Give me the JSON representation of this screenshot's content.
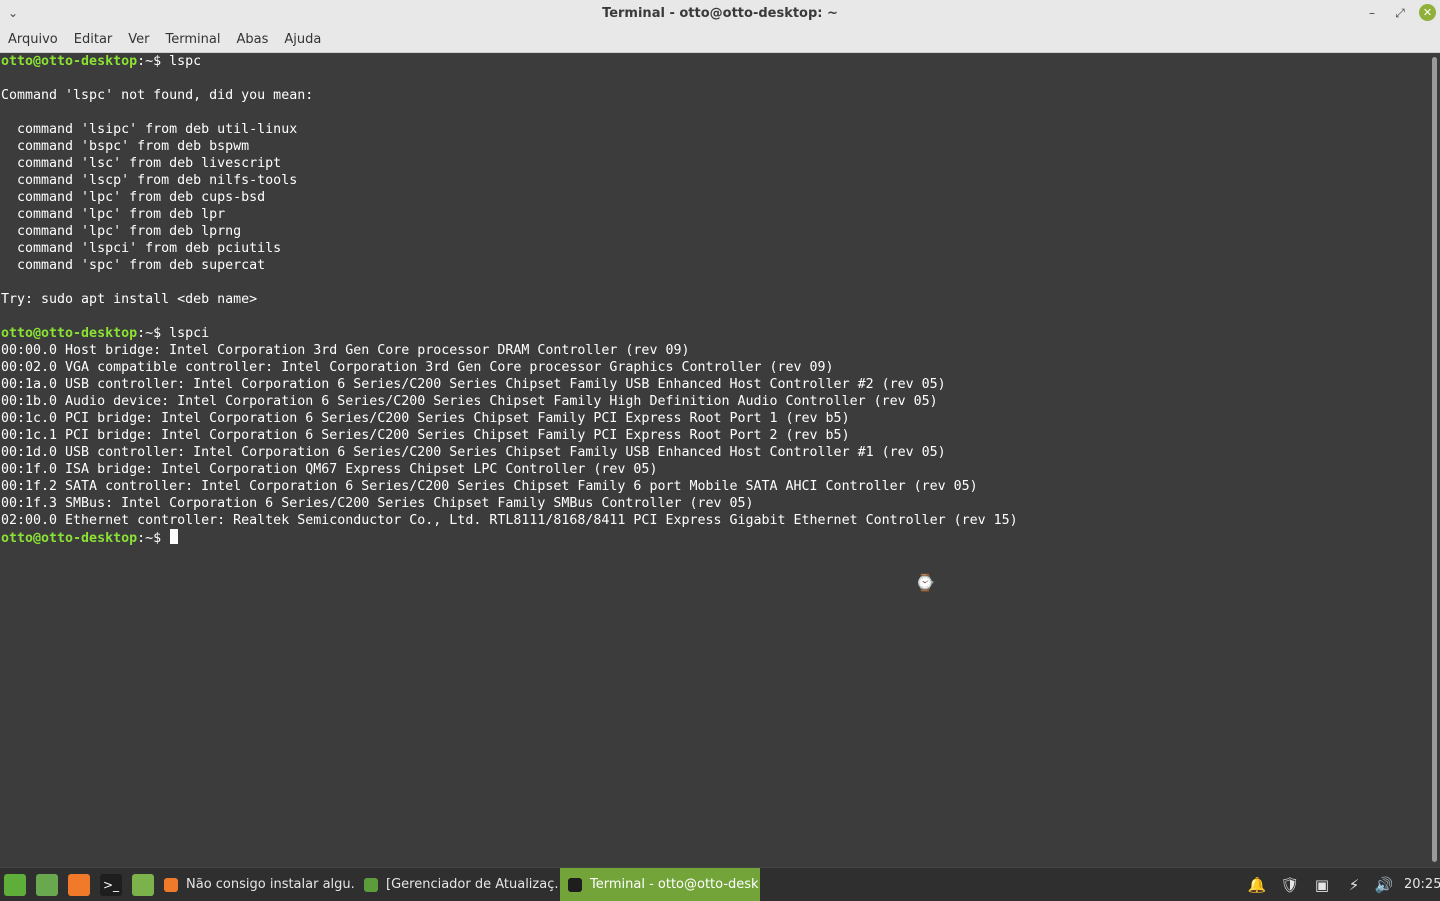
{
  "window": {
    "title": "Terminal - otto@otto-desktop: ~",
    "menu_icon": "chevron-down-icon",
    "minimize_icon": "minimize-icon",
    "maximize_icon": "maximize-icon",
    "close_icon": "close-icon"
  },
  "menu": {
    "items": [
      "Arquivo",
      "Editar",
      "Ver",
      "Terminal",
      "Abas",
      "Ajuda"
    ]
  },
  "terminal": {
    "prompt_user": "otto@otto-desktop",
    "prompt_path": ":~$",
    "lines": [
      {
        "kind": "prompt",
        "cmd": " lspc"
      },
      {
        "kind": "out",
        "text": ""
      },
      {
        "kind": "out",
        "text": "Command 'lspc' not found, did you mean:"
      },
      {
        "kind": "out",
        "text": ""
      },
      {
        "kind": "out",
        "text": "  command 'lsipc' from deb util-linux"
      },
      {
        "kind": "out",
        "text": "  command 'bspc' from deb bspwm"
      },
      {
        "kind": "out",
        "text": "  command 'lsc' from deb livescript"
      },
      {
        "kind": "out",
        "text": "  command 'lscp' from deb nilfs-tools"
      },
      {
        "kind": "out",
        "text": "  command 'lpc' from deb cups-bsd"
      },
      {
        "kind": "out",
        "text": "  command 'lpc' from deb lpr"
      },
      {
        "kind": "out",
        "text": "  command 'lpc' from deb lprng"
      },
      {
        "kind": "out",
        "text": "  command 'lspci' from deb pciutils"
      },
      {
        "kind": "out",
        "text": "  command 'spc' from deb supercat"
      },
      {
        "kind": "out",
        "text": ""
      },
      {
        "kind": "out",
        "text": "Try: sudo apt install <deb name>"
      },
      {
        "kind": "out",
        "text": ""
      },
      {
        "kind": "prompt",
        "cmd": " lspci"
      },
      {
        "kind": "out",
        "text": "00:00.0 Host bridge: Intel Corporation 3rd Gen Core processor DRAM Controller (rev 09)"
      },
      {
        "kind": "out",
        "text": "00:02.0 VGA compatible controller: Intel Corporation 3rd Gen Core processor Graphics Controller (rev 09)"
      },
      {
        "kind": "out",
        "text": "00:1a.0 USB controller: Intel Corporation 6 Series/C200 Series Chipset Family USB Enhanced Host Controller #2 (rev 05)"
      },
      {
        "kind": "out",
        "text": "00:1b.0 Audio device: Intel Corporation 6 Series/C200 Series Chipset Family High Definition Audio Controller (rev 05)"
      },
      {
        "kind": "out",
        "text": "00:1c.0 PCI bridge: Intel Corporation 6 Series/C200 Series Chipset Family PCI Express Root Port 1 (rev b5)"
      },
      {
        "kind": "out",
        "text": "00:1c.1 PCI bridge: Intel Corporation 6 Series/C200 Series Chipset Family PCI Express Root Port 2 (rev b5)"
      },
      {
        "kind": "out",
        "text": "00:1d.0 USB controller: Intel Corporation 6 Series/C200 Series Chipset Family USB Enhanced Host Controller #1 (rev 05)"
      },
      {
        "kind": "out",
        "text": "00:1f.0 ISA bridge: Intel Corporation QM67 Express Chipset LPC Controller (rev 05)"
      },
      {
        "kind": "out",
        "text": "00:1f.2 SATA controller: Intel Corporation 6 Series/C200 Series Chipset Family 6 port Mobile SATA AHCI Controller (rev 05)"
      },
      {
        "kind": "out",
        "text": "00:1f.3 SMBus: Intel Corporation 6 Series/C200 Series Chipset Family SMBus Controller (rev 05)"
      },
      {
        "kind": "out",
        "text": "02:00.0 Ethernet controller: Realtek Semiconductor Co., Ltd. RTL8111/8168/8411 PCI Express Gigabit Ethernet Controller (rev 15)"
      },
      {
        "kind": "prompt",
        "cmd": " ",
        "cursor": true
      }
    ]
  },
  "taskbar": {
    "launchers": [
      {
        "icon": "mint-menu-icon",
        "color": "#5fae3a"
      },
      {
        "icon": "show-desktop-icon",
        "color": "#6aa84f"
      },
      {
        "icon": "firefox-icon",
        "color": "#f07a2a"
      },
      {
        "icon": "terminal-icon",
        "color": "#1e1e1e"
      },
      {
        "icon": "files-icon",
        "color": "#7bb24b"
      }
    ],
    "tasks": [
      {
        "label": "Não consigo instalar algu...",
        "icon": "firefox-icon",
        "color": "#f07a2a",
        "active": false
      },
      {
        "label": "[Gerenciador de Atualizaç...",
        "icon": "update-manager-icon",
        "color": "#5d9c3b",
        "active": false
      },
      {
        "label": "Terminal - otto@otto-desk...",
        "icon": "terminal-icon",
        "color": "#1e1e1e",
        "active": true
      }
    ],
    "tray": [
      "notifications-icon",
      "shield-icon",
      "network-icon",
      "power-icon",
      "volume-icon"
    ],
    "clock": "20:25"
  },
  "colors": {
    "terminal_bg": "#3c3c3c",
    "prompt_green": "#8ae234",
    "active_task": "#73a43a"
  }
}
